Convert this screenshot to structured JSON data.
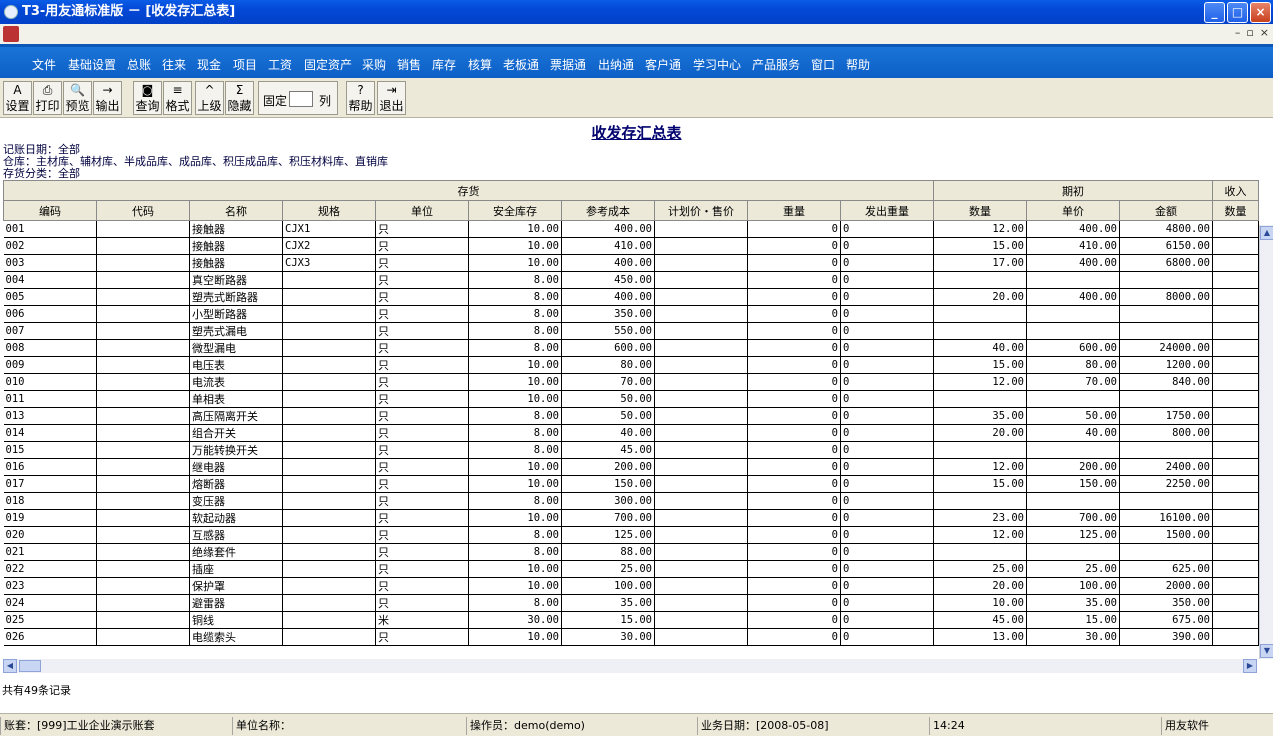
{
  "window": {
    "title": "T3-用友通标准版 － [收发存汇总表]",
    "min": "_",
    "max": "□",
    "close": "×"
  },
  "mdi": {
    "min": "–",
    "restore": "▫",
    "close": "×"
  },
  "menu": [
    "文件",
    "基础设置",
    "总账",
    "往来",
    "现金",
    "项目",
    "工资",
    "固定资产",
    "采购",
    "销售",
    "库存",
    "核算",
    "老板通",
    "票据通",
    "出纳通",
    "客户通",
    "学习中心",
    "产品服务",
    "窗口",
    "帮助"
  ],
  "toolbar": [
    {
      "id": "settings",
      "icon": "A",
      "label": "设置"
    },
    {
      "id": "print",
      "icon": "⎙",
      "label": "打印"
    },
    {
      "id": "preview",
      "icon": "🔍",
      "label": "预览"
    },
    {
      "id": "export",
      "icon": "→",
      "label": "输出"
    },
    {
      "id": "query",
      "icon": "◙",
      "label": "查询"
    },
    {
      "id": "format",
      "icon": "≡",
      "label": "格式"
    },
    {
      "id": "up",
      "icon": "^",
      "label": "上级"
    },
    {
      "id": "hide",
      "icon": "Σ",
      "label": "隐藏"
    },
    {
      "id": "help",
      "icon": "?",
      "label": "帮助"
    },
    {
      "id": "exit",
      "icon": "⇥",
      "label": "退出"
    }
  ],
  "fixed": {
    "label1": "固定",
    "label2": "列",
    "value": ""
  },
  "report": {
    "title": "收发存汇总表",
    "info": [
      "记账日期：全部",
      "仓库：主材库、辅材库、半成品库、成品库、积压成品库、积压材料库、直销库",
      "存货分类：全部"
    ],
    "group_headers": [
      "存货",
      "期初",
      "收入"
    ],
    "columns": [
      "编码",
      "代码",
      "名称",
      "规格",
      "单位",
      "安全库存",
      "参考成本",
      "计划价・售价",
      "重量",
      "发出重量",
      "数量",
      "单价",
      "金额",
      "数量"
    ],
    "rows": [
      [
        "001",
        "",
        "接触器",
        "CJX1",
        "只",
        "10.00",
        "400.00",
        "",
        "0",
        "0",
        "12.00",
        "400.00",
        "4800.00",
        ""
      ],
      [
        "002",
        "",
        "接触器",
        "CJX2",
        "只",
        "10.00",
        "410.00",
        "",
        "0",
        "0",
        "15.00",
        "410.00",
        "6150.00",
        ""
      ],
      [
        "003",
        "",
        "接触器",
        "CJX3",
        "只",
        "10.00",
        "400.00",
        "",
        "0",
        "0",
        "17.00",
        "400.00",
        "6800.00",
        ""
      ],
      [
        "004",
        "",
        "真空断路器",
        "",
        "只",
        "8.00",
        "450.00",
        "",
        "0",
        "0",
        "",
        "",
        "",
        ""
      ],
      [
        "005",
        "",
        "塑壳式断路器",
        "",
        "只",
        "8.00",
        "400.00",
        "",
        "0",
        "0",
        "20.00",
        "400.00",
        "8000.00",
        ""
      ],
      [
        "006",
        "",
        "小型断路器",
        "",
        "只",
        "8.00",
        "350.00",
        "",
        "0",
        "0",
        "",
        "",
        "",
        ""
      ],
      [
        "007",
        "",
        "塑壳式漏电",
        "",
        "只",
        "8.00",
        "550.00",
        "",
        "0",
        "0",
        "",
        "",
        "",
        ""
      ],
      [
        "008",
        "",
        "微型漏电",
        "",
        "只",
        "8.00",
        "600.00",
        "",
        "0",
        "0",
        "40.00",
        "600.00",
        "24000.00",
        ""
      ],
      [
        "009",
        "",
        "电压表",
        "",
        "只",
        "10.00",
        "80.00",
        "",
        "0",
        "0",
        "15.00",
        "80.00",
        "1200.00",
        ""
      ],
      [
        "010",
        "",
        "电流表",
        "",
        "只",
        "10.00",
        "70.00",
        "",
        "0",
        "0",
        "12.00",
        "70.00",
        "840.00",
        ""
      ],
      [
        "011",
        "",
        "单相表",
        "",
        "只",
        "10.00",
        "50.00",
        "",
        "0",
        "0",
        "",
        "",
        "",
        ""
      ],
      [
        "013",
        "",
        "高压隔离开关",
        "",
        "只",
        "8.00",
        "50.00",
        "",
        "0",
        "0",
        "35.00",
        "50.00",
        "1750.00",
        ""
      ],
      [
        "014",
        "",
        "组合开关",
        "",
        "只",
        "8.00",
        "40.00",
        "",
        "0",
        "0",
        "20.00",
        "40.00",
        "800.00",
        ""
      ],
      [
        "015",
        "",
        "万能转换开关",
        "",
        "只",
        "8.00",
        "45.00",
        "",
        "0",
        "0",
        "",
        "",
        "",
        ""
      ],
      [
        "016",
        "",
        "继电器",
        "",
        "只",
        "10.00",
        "200.00",
        "",
        "0",
        "0",
        "12.00",
        "200.00",
        "2400.00",
        ""
      ],
      [
        "017",
        "",
        "熔断器",
        "",
        "只",
        "10.00",
        "150.00",
        "",
        "0",
        "0",
        "15.00",
        "150.00",
        "2250.00",
        ""
      ],
      [
        "018",
        "",
        "变压器",
        "",
        "只",
        "8.00",
        "300.00",
        "",
        "0",
        "0",
        "",
        "",
        "",
        ""
      ],
      [
        "019",
        "",
        "软起动器",
        "",
        "只",
        "10.00",
        "700.00",
        "",
        "0",
        "0",
        "23.00",
        "700.00",
        "16100.00",
        ""
      ],
      [
        "020",
        "",
        "互感器",
        "",
        "只",
        "8.00",
        "125.00",
        "",
        "0",
        "0",
        "12.00",
        "125.00",
        "1500.00",
        ""
      ],
      [
        "021",
        "",
        "绝缘套件",
        "",
        "只",
        "8.00",
        "88.00",
        "",
        "0",
        "0",
        "",
        "",
        "",
        ""
      ],
      [
        "022",
        "",
        "插座",
        "",
        "只",
        "10.00",
        "25.00",
        "",
        "0",
        "0",
        "25.00",
        "25.00",
        "625.00",
        ""
      ],
      [
        "023",
        "",
        "保护罩",
        "",
        "只",
        "10.00",
        "100.00",
        "",
        "0",
        "0",
        "20.00",
        "100.00",
        "2000.00",
        ""
      ],
      [
        "024",
        "",
        "避雷器",
        "",
        "只",
        "8.00",
        "35.00",
        "",
        "0",
        "0",
        "10.00",
        "35.00",
        "350.00",
        ""
      ],
      [
        "025",
        "",
        "铜线",
        "",
        "米",
        "30.00",
        "15.00",
        "",
        "0",
        "0",
        "45.00",
        "15.00",
        "675.00",
        ""
      ],
      [
        "026",
        "",
        "电缆索头",
        "",
        "只",
        "10.00",
        "30.00",
        "",
        "0",
        "0",
        "13.00",
        "30.00",
        "390.00",
        ""
      ]
    ]
  },
  "record_count": "共有49条记录",
  "status": [
    "账套：[999]工业企业演示账套",
    "单位名称：",
    "操作员：demo(demo)",
    "业务日期：[2008-05-08]",
    "14:24",
    "用友软件"
  ],
  "colors": {
    "title": "#0348d6",
    "menu": "#1a74d8",
    "panel": "#ece9d8",
    "report_title": "#00006e"
  }
}
